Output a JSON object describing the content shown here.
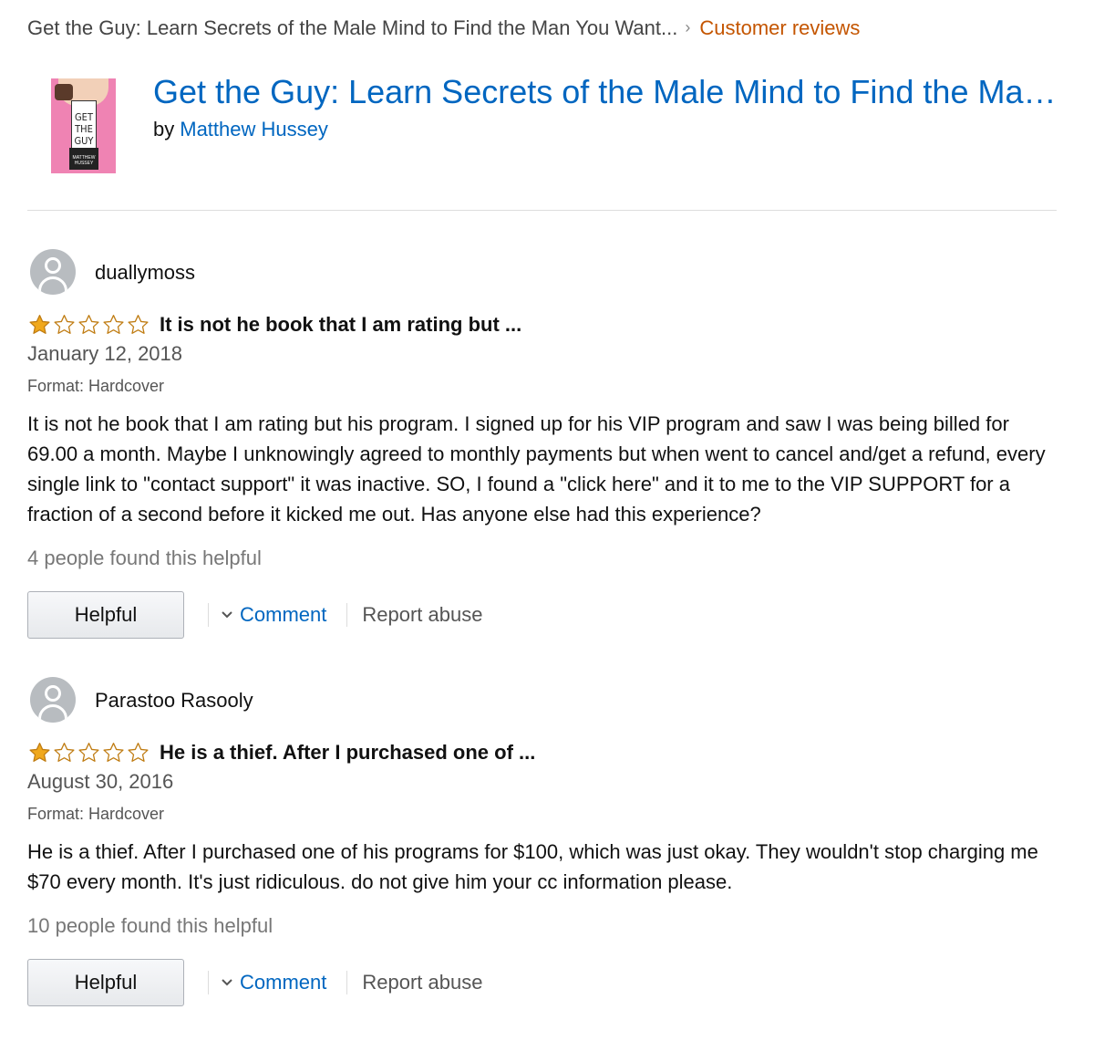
{
  "breadcrumb": {
    "product": "Get the Guy: Learn Secrets of the Male Mind to Find the Man You Want...",
    "separator": "›",
    "current": "Customer reviews"
  },
  "product": {
    "title": "Get the Guy: Learn Secrets of the Male Mind to Find the Man You Want and the Love You Deserve",
    "by_label": "by",
    "author": "Matthew Hussey",
    "cover_title": "GET THE GUY",
    "cover_author": "MATTHEW HUSSEY"
  },
  "colors": {
    "link": "#0066c0",
    "breadcrumb_current": "#c45500",
    "star_filled": "#f0a81c",
    "star_empty_stroke": "#c07d14"
  },
  "reviews": [
    {
      "reviewer": "duallymoss",
      "rating": 1,
      "max_rating": 5,
      "title": "It is not he book that I am rating but ...",
      "date": "January 12, 2018",
      "format": "Format: Hardcover",
      "body": "It is not he book that I am rating but his program. I signed up for his VIP program and saw I was being billed for 69.00 a month. Maybe I unknowingly agreed to monthly payments but when went to cancel and/get a refund, every single link to \"contact support\" it was inactive. SO, I found a \"click here\" and it to me to the VIP SUPPORT for a fraction of a second before it kicked me out. Has anyone else had this experience?",
      "helpful_count": "4 people found this helpful",
      "helpful_label": "Helpful",
      "comment_label": "Comment",
      "report_label": "Report abuse"
    },
    {
      "reviewer": "Parastoo Rasooly",
      "rating": 1,
      "max_rating": 5,
      "title": "He is a thief. After I purchased one of ...",
      "date": "August 30, 2016",
      "format": "Format: Hardcover",
      "body": "He is a thief. After I purchased one of his programs for $100, which was just okay. They wouldn't stop charging me $70 every month. It's just ridiculous. do not give him your cc information please.",
      "helpful_count": "10 people found this helpful",
      "helpful_label": "Helpful",
      "comment_label": "Comment",
      "report_label": "Report abuse"
    }
  ]
}
